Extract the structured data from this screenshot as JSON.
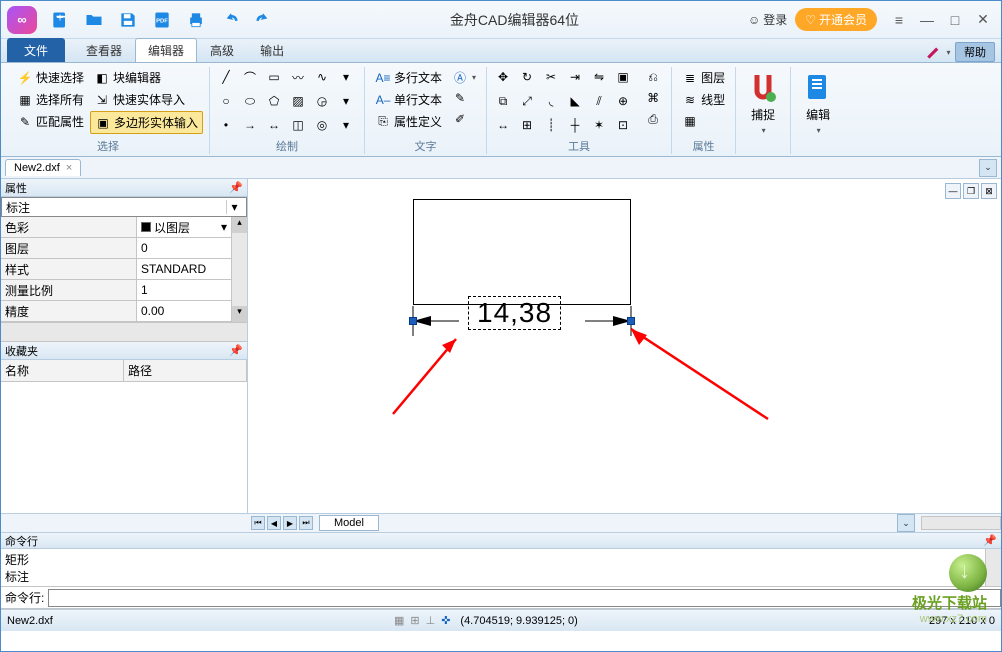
{
  "title": "金舟CAD编辑器64位",
  "login_label": "登录",
  "vip_label": "开通会员",
  "tabs": {
    "file": "文件",
    "viewer": "查看器",
    "editor": "编辑器",
    "advanced": "高级",
    "output": "输出"
  },
  "help_label": "帮助",
  "ribbon": {
    "select": {
      "label": "选择",
      "quick_select": "快速选择",
      "select_all": "选择所有",
      "match_props": "匹配属性",
      "block_editor": "块编辑器",
      "quick_import": "快速实体导入",
      "polygon_input": "多边形实体输入"
    },
    "draw": {
      "label": "绘制"
    },
    "text": {
      "label": "文字",
      "multiline": "多行文本",
      "singleline": "单行文本",
      "props_def": "属性定义"
    },
    "tools": {
      "label": "工具"
    },
    "props": {
      "label": "属性",
      "layer": "图层",
      "linetype": "线型"
    },
    "snap": {
      "label": "捕捉"
    },
    "edit": {
      "label": "编辑"
    }
  },
  "doc_tab": "New2.dxf",
  "panels": {
    "properties_title": "属性",
    "object_type": "标注",
    "rows": {
      "color_k": "色彩",
      "color_v": "以图层",
      "layer_k": "图层",
      "layer_v": "0",
      "style_k": "样式",
      "style_v": "STANDARD",
      "scale_k": "测量比例",
      "scale_v": "1",
      "precision_k": "精度",
      "precision_v": "0.00"
    },
    "favorites_title": "收藏夹",
    "fav_name": "名称",
    "fav_path": "路径"
  },
  "canvas": {
    "dimension_text": "14,38"
  },
  "model_tab": "Model",
  "command": {
    "title": "命令行",
    "log_line1": "矩形",
    "log_line2": "标注",
    "prompt": "命令行:"
  },
  "status": {
    "filename": "New2.dxf",
    "coords": "(4.704519; 9.939125; 0)",
    "page": "297 x 210 x 0"
  },
  "watermark": {
    "line1": "极光下载站",
    "line2": "www.xz7.com"
  }
}
